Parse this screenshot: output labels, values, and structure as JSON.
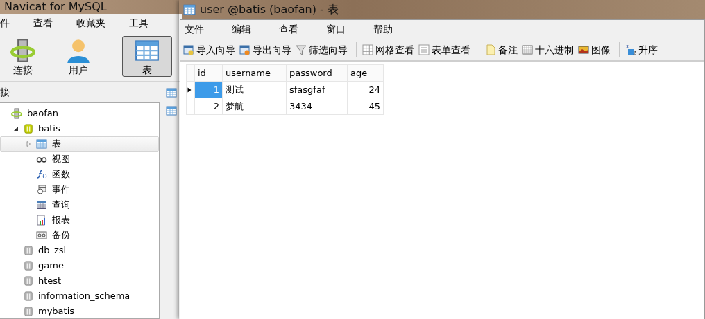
{
  "main_window": {
    "title": "Navicat for MySQL",
    "menu": [
      "件",
      "查看",
      "收藏夹",
      "工具"
    ],
    "toolbar": [
      {
        "label": "连接",
        "kind": "connection",
        "selected": false
      },
      {
        "label": "用户",
        "kind": "user",
        "selected": false
      },
      {
        "label": "表",
        "kind": "table",
        "selected": true
      }
    ],
    "pane_title": "接",
    "tree": [
      {
        "label": "baofan",
        "kind": "connection",
        "children": [
          {
            "label": "batis",
            "kind": "database",
            "open": true,
            "expanded": true,
            "children": [
              {
                "label": "表",
                "kind": "table",
                "expanded": false,
                "selected": true
              },
              {
                "label": "视图",
                "kind": "view",
                "selected": false
              },
              {
                "label": "函数",
                "kind": "function",
                "selected": false
              },
              {
                "label": "事件",
                "kind": "event",
                "selected": false
              },
              {
                "label": "查询",
                "kind": "query",
                "selected": false
              },
              {
                "label": "报表",
                "kind": "report",
                "selected": false
              },
              {
                "label": "备份",
                "kind": "backup",
                "selected": false
              }
            ]
          },
          {
            "label": "db_zsl",
            "kind": "database",
            "open": false
          },
          {
            "label": "game",
            "kind": "database",
            "open": false
          },
          {
            "label": "htest",
            "kind": "database",
            "open": false
          },
          {
            "label": "information_schema",
            "kind": "database",
            "open": false
          },
          {
            "label": "mybatis",
            "kind": "database",
            "open": false
          }
        ]
      }
    ]
  },
  "table_window": {
    "title": "user @batis (baofan) - 表",
    "menu": [
      "文件",
      "编辑",
      "查看",
      "窗口",
      "帮助"
    ],
    "toolbar": [
      [
        {
          "label": "导入向导",
          "kind": "import"
        },
        {
          "label": "导出向导",
          "kind": "export"
        },
        {
          "label": "筛选向导",
          "kind": "filter"
        }
      ],
      [
        {
          "label": "网格查看",
          "kind": "grid"
        },
        {
          "label": "表单查看",
          "kind": "form"
        }
      ],
      [
        {
          "label": "备注",
          "kind": "memo"
        },
        {
          "label": "十六进制",
          "kind": "hex"
        },
        {
          "label": "图像",
          "kind": "image"
        }
      ],
      [
        {
          "label": "升序",
          "kind": "sort"
        }
      ]
    ],
    "grid": {
      "columns": [
        "id",
        "username",
        "password",
        "age"
      ],
      "rows": [
        {
          "cells": [
            "1",
            "测试",
            "sfasgfaf",
            "24"
          ],
          "selected": true
        },
        {
          "cells": [
            "2",
            "梦航",
            "3434",
            "45"
          ],
          "selected": false
        }
      ]
    }
  }
}
